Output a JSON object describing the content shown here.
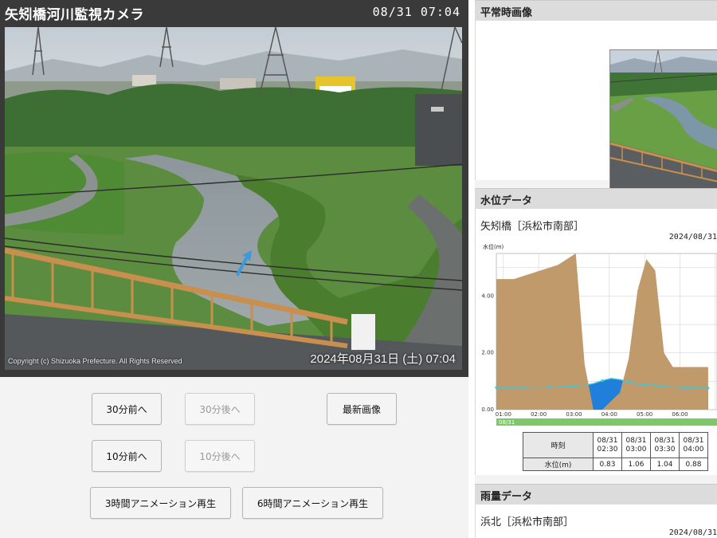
{
  "camera": {
    "title": "矢矧橋河川監視カメラ",
    "datetime": "08/31 07:04",
    "copyright": "Copyright (c) Shizuoka Prefecture. All Rights Reserved",
    "timestamp_overlay": "2024年08月31日 (土) 07:04"
  },
  "buttons": {
    "back_30": "30分前へ",
    "forward_30": "30分後へ",
    "latest": "最新画像",
    "back_10": "10分前へ",
    "forward_10": "10分後へ",
    "anim_3h": "3時間アニメーション再生",
    "anim_6h": "6時間アニメーション再生"
  },
  "side": {
    "normal_image_header": "平常時画像",
    "water_level_header": "水位データ",
    "water_station": "矢矧橋［浜松市南部］",
    "water_date": "2024/08/31",
    "rain_header": "雨量データ",
    "rain_station": "浜北［浜松市南部］",
    "rain_date": "2024/08/31"
  },
  "water_table": {
    "time_header": "時刻",
    "level_header": "水位(m)",
    "times": [
      [
        "08/31",
        "02:30"
      ],
      [
        "08/31",
        "03:00"
      ],
      [
        "08/31",
        "03:30"
      ],
      [
        "08/31",
        "04:00"
      ]
    ],
    "levels": [
      "0.83",
      "1.06",
      "1.04",
      "0.88"
    ]
  },
  "chart_data": {
    "type": "area",
    "ylabel": "水位(m)",
    "yticks": [
      "4.00",
      "2.00",
      "0.00"
    ],
    "ylim": [
      0,
      5.5
    ],
    "xticks": [
      "01:00",
      "02:00",
      "03:00",
      "04:00",
      "05:00",
      "06:00"
    ],
    "date_label": "08/31",
    "grid": true,
    "colors": {
      "rainfall_area": "#c19a6b",
      "water_area": "#1f7fdb",
      "water_line": "#40c8d8",
      "date_band": "#7fc86a"
    },
    "x": [
      0.0,
      0.25,
      0.5,
      0.75,
      1.0,
      1.25,
      1.5,
      1.75,
      2.0,
      2.25,
      2.5,
      2.75,
      3.0,
      3.25,
      3.5,
      3.75,
      4.0,
      4.25,
      4.5,
      4.75,
      5.0,
      5.25,
      5.5,
      5.75,
      6.0
    ],
    "series": [
      {
        "values": [
          4.6,
          4.6,
          4.6,
          4.7,
          4.8,
          4.9,
          5.0,
          5.1,
          5.3,
          5.5,
          1.6,
          0.0,
          0.0,
          0.3,
          0.6,
          1.8,
          4.2,
          5.3,
          4.9,
          2.0,
          1.5,
          1.5,
          1.5,
          1.5,
          1.5
        ]
      },
      {
        "values": [
          0.78,
          0.78,
          0.78,
          0.79,
          0.79,
          0.8,
          0.8,
          0.81,
          0.82,
          0.84,
          0.86,
          0.92,
          1.02,
          1.1,
          1.06,
          0.98,
          0.9,
          0.88,
          0.85,
          0.82,
          0.8,
          0.78,
          0.77,
          0.76,
          0.76
        ]
      }
    ]
  }
}
